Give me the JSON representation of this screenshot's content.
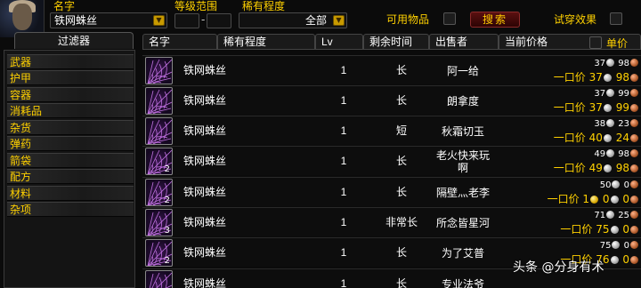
{
  "top": {
    "name_label": "名字",
    "name_value": "铁网蛛丝",
    "level_label": "等级范围",
    "level_sep": "-",
    "rarity_label": "稀有程度",
    "rarity_value": "全部",
    "usable_label": "可用物品",
    "search_label": "搜索",
    "tryon_label": "试穿效果"
  },
  "filter": {
    "tab_label": "过滤器",
    "items": [
      "武器",
      "护甲",
      "容器",
      "消耗品",
      "杂货",
      "弹药",
      "箭袋",
      "配方",
      "材料",
      "杂项"
    ]
  },
  "columns": {
    "name": "名字",
    "rarity": "稀有程度",
    "lv": "Lv",
    "time": "剩余时间",
    "seller": "出售者",
    "price": "当前价格",
    "unit_price": "单价"
  },
  "buyout_label": "一口价",
  "rows": [
    {
      "name": "铁网蛛丝",
      "count": "",
      "lv": "1",
      "time": "长",
      "seller": "阿一给",
      "bid_silver": "37",
      "bid_copper": "98",
      "bo_gold": "",
      "bo_silver": "37",
      "bo_copper": "98"
    },
    {
      "name": "铁网蛛丝",
      "count": "",
      "lv": "1",
      "time": "长",
      "seller": "朗拿度",
      "bid_silver": "37",
      "bid_copper": "99",
      "bo_gold": "",
      "bo_silver": "37",
      "bo_copper": "99"
    },
    {
      "name": "铁网蛛丝",
      "count": "",
      "lv": "1",
      "time": "短",
      "seller": "秋霜切玉",
      "bid_silver": "38",
      "bid_copper": "23",
      "bo_gold": "",
      "bo_silver": "40",
      "bo_copper": "24"
    },
    {
      "name": "铁网蛛丝",
      "count": "2",
      "lv": "1",
      "time": "长",
      "seller": "老火快来玩啊",
      "bid_silver": "49",
      "bid_copper": "98",
      "bo_gold": "",
      "bo_silver": "49",
      "bo_copper": "98"
    },
    {
      "name": "铁网蛛丝",
      "count": "2",
      "lv": "1",
      "time": "长",
      "seller": "隔壁灬老李",
      "bid_silver": "50",
      "bid_copper": "0",
      "bo_gold": "1",
      "bo_silver": "0",
      "bo_copper": "0"
    },
    {
      "name": "铁网蛛丝",
      "count": "3",
      "lv": "1",
      "time": "非常长",
      "seller": "所念皆星河",
      "bid_silver": "71",
      "bid_copper": "25",
      "bo_gold": "",
      "bo_silver": "75",
      "bo_copper": "0"
    },
    {
      "name": "铁网蛛丝",
      "count": "2",
      "lv": "1",
      "time": "长",
      "seller": "为了艾普",
      "bid_silver": "75",
      "bid_copper": "0",
      "bo_gold": "",
      "bo_silver": "76",
      "bo_copper": "0"
    },
    {
      "name": "铁网蛛丝",
      "count": "",
      "lv": "1",
      "time": "长",
      "seller": "专业法爷",
      "bid_silver": "",
      "bid_copper": "",
      "bo_gold": "",
      "bo_silver": "",
      "bo_copper": ""
    }
  ],
  "watermark": "头条 @分身有术"
}
